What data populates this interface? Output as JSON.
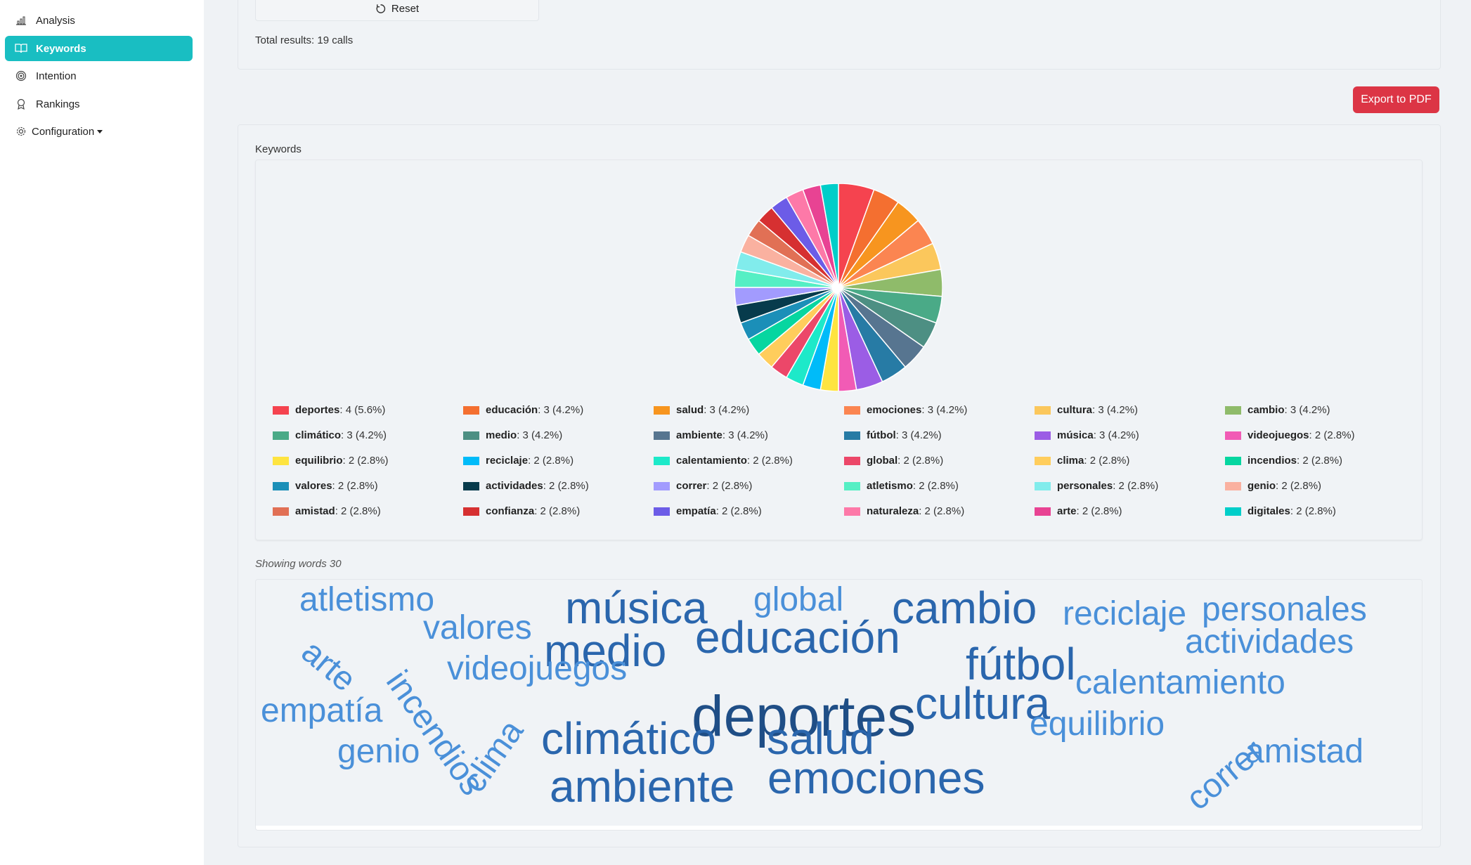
{
  "sidebar": {
    "items": [
      {
        "label": "Analysis",
        "icon": "bar-chart-icon"
      },
      {
        "label": "Keywords",
        "icon": "book-icon",
        "active": true
      },
      {
        "label": "Intention",
        "icon": "target-icon"
      },
      {
        "label": "Rankings",
        "icon": "award-icon"
      },
      {
        "label": "Configuration",
        "icon": "gear-icon",
        "dropdown": true
      }
    ]
  },
  "filters": {
    "reset_label": "Reset",
    "total_results": "Total results: 19 calls"
  },
  "export_label": "Export to PDF",
  "keywords_title": "Keywords",
  "showing_words": "Showing words 30",
  "colors": {
    "accent": "#19bec2",
    "export": "#dc3545",
    "cloud_dark": "#1f4e86",
    "cloud_mid": "#2f6fb6",
    "cloud_light": "#4a90d9"
  },
  "chart_data": {
    "type": "pie",
    "categories": [
      "deportes",
      "educación",
      "salud",
      "emociones",
      "cultura",
      "cambio",
      "climático",
      "medio",
      "ambiente",
      "fútbol",
      "música",
      "videojuegos",
      "equilibrio",
      "reciclaje",
      "calentamiento",
      "global",
      "clima",
      "incendios",
      "valores",
      "actividades",
      "correr",
      "atletismo",
      "personales",
      "genio",
      "amistad",
      "confianza",
      "empatía",
      "naturaleza",
      "arte",
      "digitales"
    ],
    "values": [
      4,
      3,
      3,
      3,
      3,
      3,
      3,
      3,
      3,
      3,
      3,
      2,
      2,
      2,
      2,
      2,
      2,
      2,
      2,
      2,
      2,
      2,
      2,
      2,
      2,
      2,
      2,
      2,
      2,
      2
    ],
    "percent_labels": [
      "4 (5.6%)",
      "3 (4.2%)",
      "3 (4.2%)",
      "3 (4.2%)",
      "3 (4.2%)",
      "3 (4.2%)",
      "3 (4.2%)",
      "3 (4.2%)",
      "3 (4.2%)",
      "3 (4.2%)",
      "3 (4.2%)",
      "2 (2.8%)",
      "2 (2.8%)",
      "2 (2.8%)",
      "2 (2.8%)",
      "2 (2.8%)",
      "2 (2.8%)",
      "2 (2.8%)",
      "2 (2.8%)",
      "2 (2.8%)",
      "2 (2.8%)",
      "2 (2.8%)",
      "2 (2.8%)",
      "2 (2.8%)",
      "2 (2.8%)",
      "2 (2.8%)",
      "2 (2.8%)",
      "2 (2.8%)",
      "2 (2.8%)",
      "2 (2.8%)"
    ],
    "colors": [
      "#f5434f",
      "#f46f30",
      "#f7951f",
      "#fb8551",
      "#fbc75c",
      "#8fbb6a",
      "#4aaa87",
      "#4d8f83",
      "#577590",
      "#277ba5",
      "#9b5de5",
      "#f15bb5",
      "#fee440",
      "#00bbf9",
      "#1de9c9",
      "#ec4769",
      "#ffcd5c",
      "#06d6a0",
      "#1b8fb8",
      "#073b4c",
      "#a29bfe",
      "#55efc4",
      "#81ecec",
      "#fab1a0",
      "#e17055",
      "#d63031",
      "#6c5ce7",
      "#fd79a8",
      "#e84393",
      "#00cec9"
    ],
    "legend_position": "bottom"
  },
  "word_cloud": [
    {
      "text": "deportes",
      "size": 82,
      "color": "#1f4e86"
    },
    {
      "text": "música",
      "size": 64,
      "color": "#2a66ad"
    },
    {
      "text": "educación",
      "size": 64,
      "color": "#2a66ad"
    },
    {
      "text": "cambio",
      "size": 64,
      "color": "#2a66ad"
    },
    {
      "text": "medio",
      "size": 64,
      "color": "#2a66ad"
    },
    {
      "text": "fútbol",
      "size": 64,
      "color": "#2a66ad"
    },
    {
      "text": "cultura",
      "size": 64,
      "color": "#2a66ad"
    },
    {
      "text": "climático",
      "size": 64,
      "color": "#2a66ad"
    },
    {
      "text": "salud",
      "size": 64,
      "color": "#2a66ad"
    },
    {
      "text": "emociones",
      "size": 64,
      "color": "#2a66ad"
    },
    {
      "text": "ambiente",
      "size": 64,
      "color": "#2a66ad"
    },
    {
      "text": "atletismo",
      "size": 48,
      "color": "#4a90d9"
    },
    {
      "text": "global",
      "size": 48,
      "color": "#4a90d9"
    },
    {
      "text": "reciclaje",
      "size": 48,
      "color": "#4a90d9"
    },
    {
      "text": "personales",
      "size": 48,
      "color": "#4a90d9"
    },
    {
      "text": "valores",
      "size": 48,
      "color": "#4a90d9"
    },
    {
      "text": "actividades",
      "size": 48,
      "color": "#4a90d9"
    },
    {
      "text": "arte",
      "size": 48,
      "color": "#4a90d9"
    },
    {
      "text": "incendios",
      "size": 48,
      "color": "#4a90d9"
    },
    {
      "text": "videojuegos",
      "size": 48,
      "color": "#4a90d9"
    },
    {
      "text": "calentamiento",
      "size": 48,
      "color": "#4a90d9"
    },
    {
      "text": "empatía",
      "size": 48,
      "color": "#4a90d9"
    },
    {
      "text": "clima",
      "size": 48,
      "color": "#4a90d9"
    },
    {
      "text": "equilibrio",
      "size": 48,
      "color": "#4a90d9"
    },
    {
      "text": "correr",
      "size": 48,
      "color": "#4a90d9"
    },
    {
      "text": "genio",
      "size": 48,
      "color": "#4a90d9"
    },
    {
      "text": "amistad",
      "size": 48,
      "color": "#4a90d9"
    }
  ]
}
